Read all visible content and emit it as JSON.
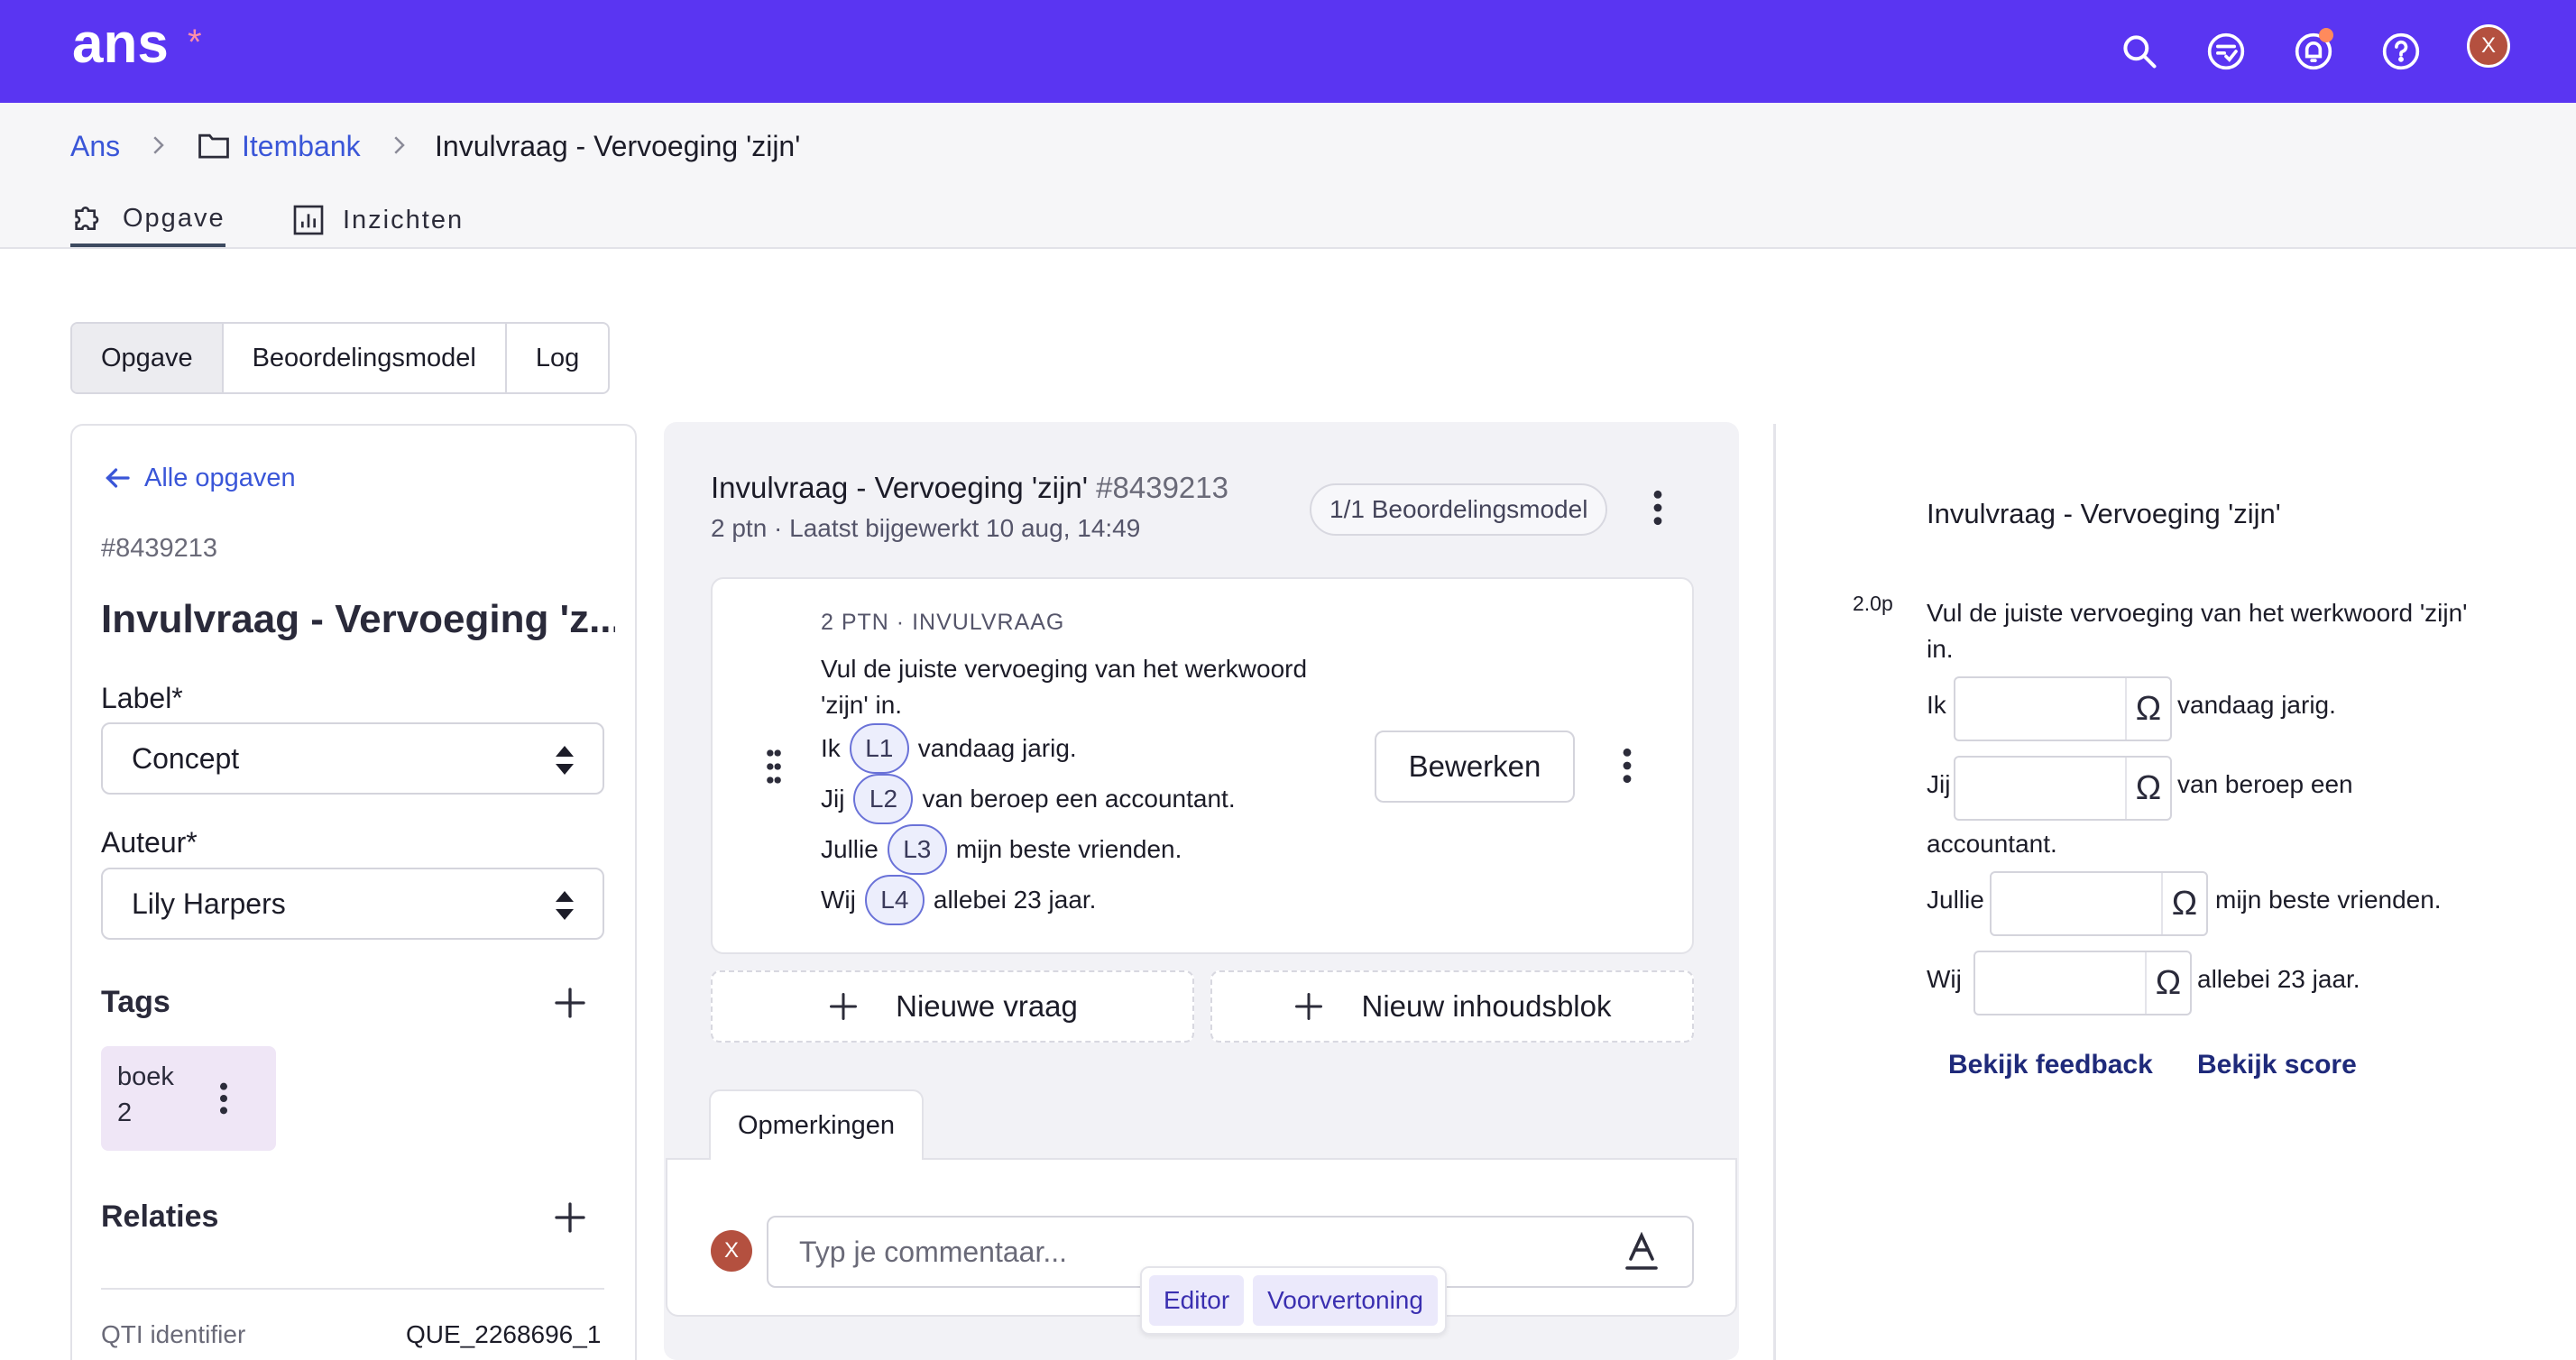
{
  "header": {
    "logo": "ans",
    "logo_mark": "*",
    "icons": [
      "search-icon",
      "checklist-icon",
      "notification-bell-icon",
      "help-icon"
    ],
    "colors": {
      "brand": "#5a35f2",
      "link": "#3a56d8",
      "avatar": "#b4503f",
      "notification_dot": "#ff8a5c"
    },
    "user_initial": "X"
  },
  "breadcrumb": {
    "root": "Ans",
    "folder": "Itembank",
    "current": "Invulvraag - Vervoeging 'zijn'"
  },
  "page_tabs": {
    "opgave": "Opgave",
    "inzichten": "Inzichten"
  },
  "segmented_tabs": {
    "opgave": "Opgave",
    "beoordelingsmodel": "Beoordelingsmodel",
    "log": "Log"
  },
  "sidebar": {
    "back_label": "Alle opgaven",
    "item_id": "#8439213",
    "title": "Invulvraag - Vervoeging 'z...",
    "label_field": {
      "label": "Label*",
      "value": "Concept"
    },
    "author_field": {
      "label": "Auteur*",
      "value": "Lily Harpers"
    },
    "tags_title": "Tags",
    "tag": {
      "name": "boek",
      "count": "2"
    },
    "relations_title": "Relaties",
    "qti": {
      "label": "QTI identifier",
      "value": "QUE_2268696_1"
    }
  },
  "main": {
    "title": "Invulvraag - Vervoeging 'zijn'",
    "id": "#8439213",
    "subtitle": "2 ptn · Laatst bijgewerkt 10 aug, 14:49",
    "badge": "1/1 Beoordelingsmodel",
    "question": {
      "meta": "2 PTN · INVULVRAAG",
      "text": "Vul de juiste vervoeging van het werkwoord 'zijn' in.",
      "lines": [
        {
          "before": "Ik",
          "gap": "L1",
          "after": "vandaag jarig."
        },
        {
          "before": "Jij",
          "gap": "L2",
          "after": "van beroep een accountant."
        },
        {
          "before": "Jullie",
          "gap": "L3",
          "after": "mijn beste vrienden."
        },
        {
          "before": "Wij",
          "gap": "L4",
          "after": "allebei 23 jaar."
        }
      ],
      "edit_label": "Bewerken"
    },
    "new_question": "Nieuwe vraag",
    "new_content_block": "Nieuw inhoudsblok",
    "comments_tab": "Opmerkingen",
    "comment_placeholder": "Typ je commentaar...",
    "comment_avatar": "X",
    "editor_toggle": {
      "editor": "Editor",
      "preview": "Voorvertoning"
    }
  },
  "preview": {
    "title": "Invulvraag - Vervoeging 'zijn'",
    "points": "2.0p",
    "text": "Vul de juiste vervoeging van het werkwoord 'zijn' in.",
    "lines": [
      {
        "before": "Ik",
        "after": "vandaag jarig."
      },
      {
        "before": "Jij",
        "after": "van beroep een",
        "wrap": "accountant."
      },
      {
        "before": "Jullie",
        "after": "mijn beste vrienden."
      },
      {
        "before": "Wij",
        "after": "allebei 23 jaar."
      }
    ],
    "special_char": "Ω",
    "feedback_link": "Bekijk feedback",
    "score_link": "Bekijk score"
  }
}
